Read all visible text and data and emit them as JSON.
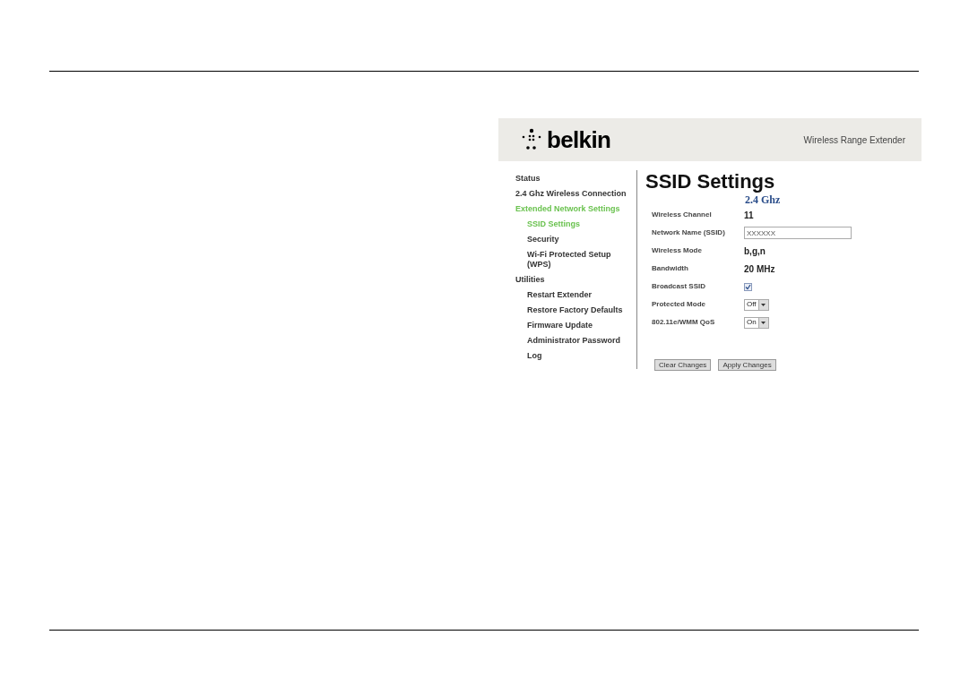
{
  "header": {
    "brand": "belkin",
    "product": "Wireless Range Extender"
  },
  "sidebar": {
    "items": [
      {
        "label": "Status",
        "selected": false
      },
      {
        "label": "2.4 Ghz Wireless Connection",
        "selected": false
      },
      {
        "label": "Extended Network Settings",
        "selected": true,
        "children": [
          {
            "label": "SSID Settings",
            "selected": true
          },
          {
            "label": "Security",
            "selected": false
          },
          {
            "label": "Wi-Fi Protected Setup (WPS)",
            "selected": false
          }
        ]
      },
      {
        "label": "Utilities",
        "selected": false,
        "children": [
          {
            "label": "Restart Extender",
            "selected": false
          },
          {
            "label": "Restore Factory Defaults",
            "selected": false
          },
          {
            "label": "Firmware Update",
            "selected": false
          },
          {
            "label": "Administrator Password",
            "selected": false
          },
          {
            "label": "Log",
            "selected": false
          }
        ]
      }
    ]
  },
  "content": {
    "title": "SSID Settings",
    "band": "2.4 Ghz",
    "fields": [
      {
        "kind": "text",
        "label": "Wireless Channel",
        "value": "11"
      },
      {
        "kind": "input",
        "label": "Network Name (SSID)",
        "value": "XXXXXX"
      },
      {
        "kind": "text",
        "label": "Wireless Mode",
        "value": "b,g,n"
      },
      {
        "kind": "text",
        "label": "Bandwidth",
        "value": "20 MHz"
      },
      {
        "kind": "checkbox",
        "label": "Broadcast SSID",
        "checked": true
      },
      {
        "kind": "select",
        "label": "Protected Mode",
        "value": "Off"
      },
      {
        "kind": "select",
        "label": "802.11e/WMM QoS",
        "value": "On"
      }
    ],
    "buttons": [
      "Clear Changes",
      "Apply Changes"
    ]
  }
}
